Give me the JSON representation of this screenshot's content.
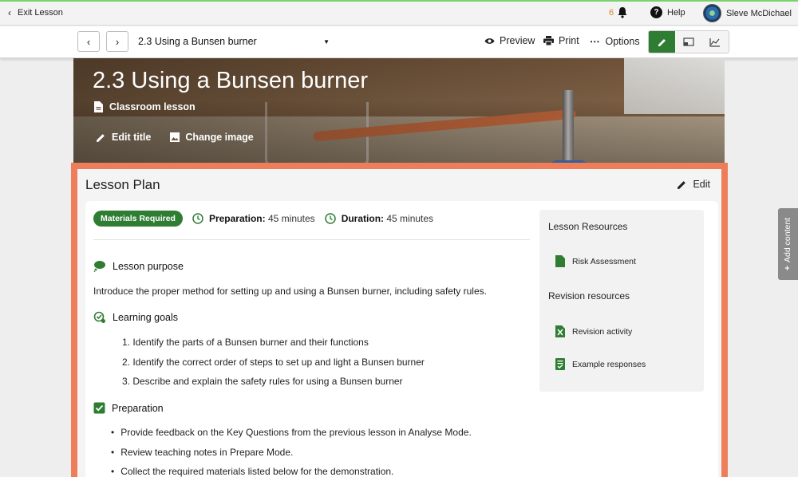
{
  "topbar": {
    "exit_label": "Exit Lesson",
    "notification_count": "6",
    "help_label": "Help",
    "user_name": "Sleve McDichael"
  },
  "toolbar": {
    "lesson_select_value": "2.3 Using a Bunsen burner",
    "preview_label": "Preview",
    "print_label": "Print",
    "options_label": "Options",
    "modes": [
      "edit",
      "present",
      "analyse"
    ],
    "active_mode": "edit"
  },
  "banner": {
    "title": "2.3 Using a Bunsen burner",
    "subtitle": "Classroom lesson",
    "edit_title_label": "Edit title",
    "change_image_label": "Change image"
  },
  "lesson_plan": {
    "title": "Lesson Plan",
    "edit_label": "Edit",
    "badge": "Materials Required",
    "preparation_label": "Preparation:",
    "preparation_value": "45 minutes",
    "duration_label": "Duration:",
    "duration_value": "45 minutes",
    "purpose_heading": "Lesson purpose",
    "purpose_text": "Introduce the proper method for setting up and using a Bunsen burner, including safety rules.",
    "goals_heading": "Learning goals",
    "goals": [
      "1. Identify the parts of a Bunsen burner and their functions",
      "2. Identify the correct order of steps to set up and light a Bunsen burner",
      "3. Describe and explain the safety rules for using a Bunsen burner"
    ],
    "preparation_heading": "Preparation",
    "preparation_items": [
      "Provide feedback on the Key Questions from the previous lesson in Analyse Mode.",
      "Review teaching notes in Prepare Mode.",
      "Collect the required materials listed below for the demonstration."
    ]
  },
  "resources": {
    "lesson_heading": "Lesson Resources",
    "lesson_items": [
      "Risk Assessment"
    ],
    "revision_heading": "Revision resources",
    "revision_items": [
      "Revision activity",
      "Example responses"
    ]
  },
  "add_content_label": "Add content",
  "colors": {
    "accent_green": "#2e7d32",
    "highlight_border": "#ee7e5a",
    "notification_orange": "#e0822a"
  }
}
